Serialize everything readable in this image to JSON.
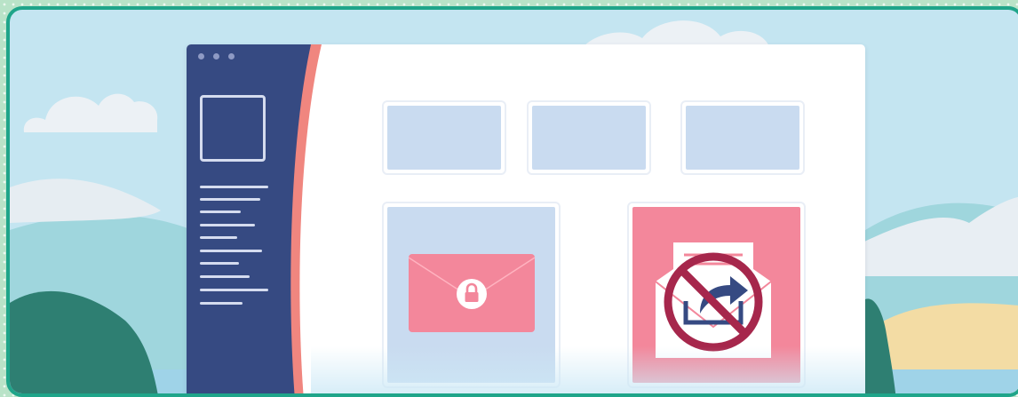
{
  "scene": {
    "background_color": "#c4e5f1",
    "frame_border_color": "#1fa58a",
    "dot_pattern_color": "#b9e3c8"
  },
  "app_window": {
    "title_dots": 3,
    "sidebar_color": "#364a82",
    "sidebar_accent_color": "#f0867f",
    "sidebar_text_lines": 10,
    "top_cards": 3
  },
  "cards": {
    "locked_email": {
      "icon": "locked-envelope-icon",
      "envelope_color": "#f3879b",
      "lock_badge_color": "#ffffff",
      "lock_color": "#f3879b"
    },
    "forward_blocked": {
      "icon": "forward-email-icon",
      "prohibited_icon": "prohibited-icon",
      "card_color": "#f3879b",
      "prohibited_color": "#a6274c",
      "arrow_color": "#364a82"
    }
  }
}
